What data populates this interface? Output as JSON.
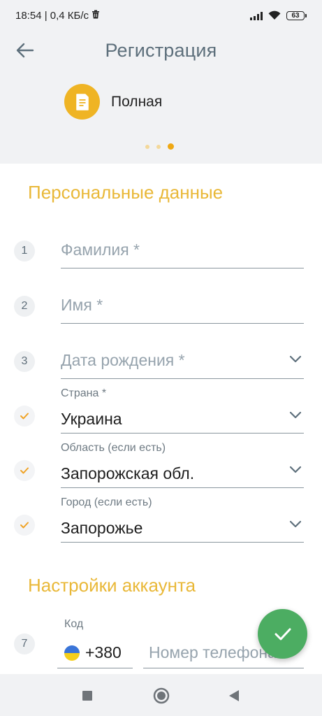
{
  "status_bar": {
    "time_and_speed": "18:54 | 0,4 КБ/с",
    "battery": "63",
    "icons": [
      "trash-icon",
      "signal-icon",
      "wifi-icon",
      "battery-icon"
    ]
  },
  "header": {
    "title": "Регистрация",
    "back_icon": "arrow-left-icon",
    "registration_type": {
      "label": "Полная",
      "icon": "document-icon"
    },
    "pager": {
      "count": 3,
      "active_index": 3
    }
  },
  "colors": {
    "accent_gold": "#e9b838",
    "icon_gold": "#efb424",
    "fab_green": "#4cad62",
    "title_gray": "#5d6f7b",
    "check_orange": "#f0a326"
  },
  "personal": {
    "section_title": "Персональные данные",
    "surname": {
      "step": "1",
      "placeholder": "Фамилия *"
    },
    "name": {
      "step": "2",
      "placeholder": "Имя *"
    },
    "birthdate": {
      "step": "3",
      "placeholder": "Дата рождения *"
    },
    "country": {
      "label": "Страна *",
      "value": "Украина"
    },
    "region": {
      "label": "Область (если есть)",
      "value": "Запорожская обл."
    },
    "city": {
      "label": "Город (если есть)",
      "value": "Запорожье"
    }
  },
  "account": {
    "section_title": "Настройки аккаунта",
    "step": "7",
    "code_label": "Код",
    "code_value": "+380",
    "phone_placeholder": "Номер телефона"
  },
  "fab": {
    "icon": "check-icon"
  },
  "navbar": {
    "icons": [
      "square-nav-icon",
      "circle-nav-icon",
      "triangle-back-nav-icon"
    ]
  }
}
